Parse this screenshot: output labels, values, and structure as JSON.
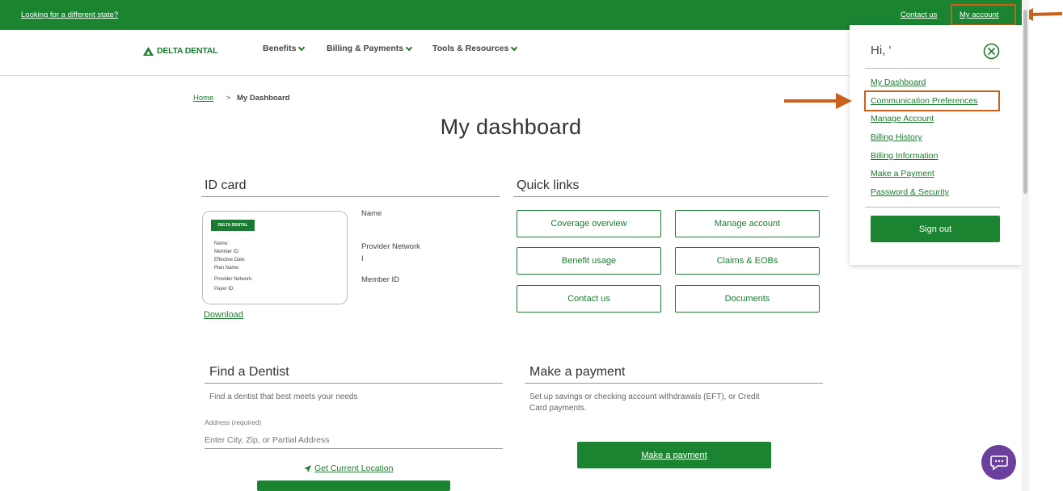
{
  "topbar": {
    "state_link": "Looking for a different state?",
    "contact_link": "Contact us",
    "account_link": "My account"
  },
  "brand": {
    "logo_text": "DELTA DENTAL"
  },
  "nav": {
    "items": [
      {
        "label": "Benefits"
      },
      {
        "label": "Billing & Payments"
      },
      {
        "label": "Tools & Resources"
      }
    ]
  },
  "breadcrumb": {
    "home": "Home",
    "separator": ">",
    "current": "My Dashboard"
  },
  "page": {
    "title": "My dashboard"
  },
  "id_card": {
    "heading": "ID card",
    "card_logo": "DELTA DENTAL",
    "card_fields": [
      "Name:",
      "Member ID:",
      "Effective Date:",
      "Plan Name:",
      "Provider Network:",
      "Payer ID:"
    ],
    "download": "Download",
    "name_label": "Name",
    "network_label": "Provider Network",
    "network_value": "I",
    "member_id_label": "Member ID"
  },
  "quick_links": {
    "heading": "Quick links",
    "items": [
      {
        "label": "Coverage overview"
      },
      {
        "label": "Manage account"
      },
      {
        "label": "Benefit usage"
      },
      {
        "label": "Claims & EOBs"
      },
      {
        "label": "Contact us"
      },
      {
        "label": "Documents"
      }
    ]
  },
  "find_dentist": {
    "heading": "Find a Dentist",
    "subtext": "Find a dentist that best meets your needs",
    "address_label": "Address (required)",
    "address_placeholder": "Enter City, Zip, or Partial Address",
    "location_link": "Get Current Location"
  },
  "payment": {
    "heading": "Make a payment",
    "subtext_line1": "Set up savings or checking account withdrawals (EFT), or Credit",
    "subtext_line2": "Card payments.",
    "button": "Make a payment"
  },
  "account_menu": {
    "greeting": "Hi, '",
    "items": [
      {
        "label": "My Dashboard"
      },
      {
        "label": "Communication Preferences"
      },
      {
        "label": "Manage Account"
      },
      {
        "label": "Billing History"
      },
      {
        "label": "Billing Information"
      },
      {
        "label": "Make a Payment"
      },
      {
        "label": "Password & Security"
      }
    ],
    "sign_out": "Sign out"
  },
  "colors": {
    "brand_green": "#1a8431",
    "annotation": "#c9611b",
    "chat": "#6b3f9c"
  }
}
